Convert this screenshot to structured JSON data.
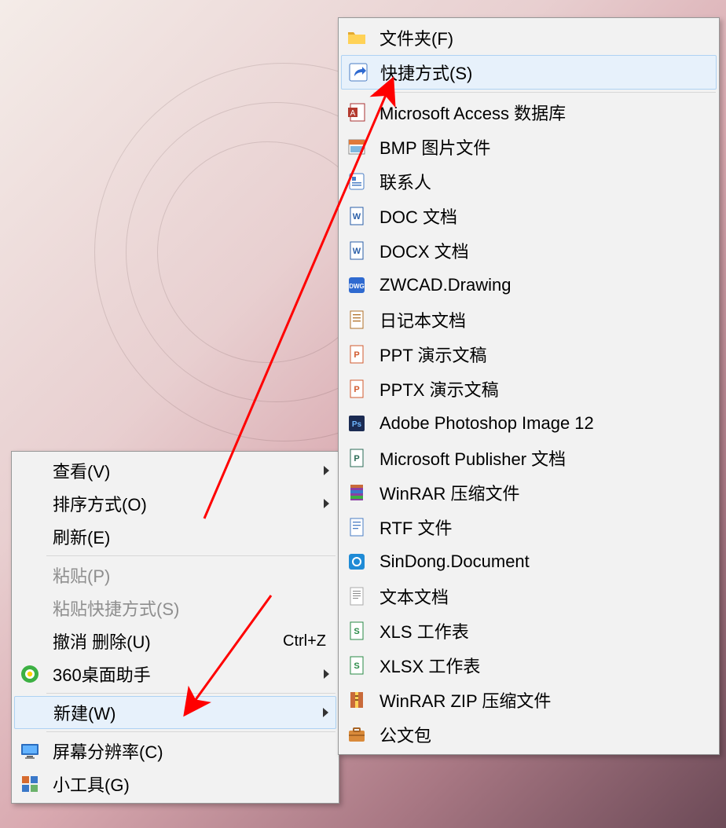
{
  "main_menu": {
    "view": {
      "label": "查看(V)"
    },
    "sort": {
      "label": "排序方式(O)"
    },
    "refresh": {
      "label": "刷新(E)"
    },
    "paste": {
      "label": "粘贴(P)"
    },
    "paste_shortcut": {
      "label": "粘贴快捷方式(S)"
    },
    "undo_delete": {
      "label": "撤消 删除(U)",
      "shortcut": "Ctrl+Z"
    },
    "helper_360": {
      "label": "360桌面助手"
    },
    "new": {
      "label": "新建(W)"
    },
    "screen_res": {
      "label": "屏幕分辨率(C)"
    },
    "gadgets": {
      "label": "小工具(G)"
    }
  },
  "sub_menu": {
    "folder": {
      "label": "文件夹(F)"
    },
    "shortcut": {
      "label": "快捷方式(S)"
    },
    "access": {
      "label": "Microsoft Access 数据库"
    },
    "bmp": {
      "label": "BMP 图片文件"
    },
    "contact": {
      "label": "联系人"
    },
    "doc": {
      "label": "DOC 文档"
    },
    "docx": {
      "label": "DOCX 文档"
    },
    "zwcad": {
      "label": "ZWCAD.Drawing"
    },
    "journal": {
      "label": "日记本文档"
    },
    "ppt": {
      "label": "PPT 演示文稿"
    },
    "pptx": {
      "label": "PPTX 演示文稿"
    },
    "psd": {
      "label": "Adobe Photoshop Image 12"
    },
    "publisher": {
      "label": "Microsoft Publisher 文档"
    },
    "rar": {
      "label": "WinRAR 压缩文件"
    },
    "rtf": {
      "label": "RTF 文件"
    },
    "sindong": {
      "label": "SinDong.Document"
    },
    "txt": {
      "label": "文本文档"
    },
    "xls": {
      "label": "XLS 工作表"
    },
    "xlsx": {
      "label": "XLSX 工作表"
    },
    "zip": {
      "label": "WinRAR ZIP 压缩文件"
    },
    "briefcase": {
      "label": "公文包"
    }
  },
  "colors": {
    "highlight_bg": "#e7f1fb",
    "highlight_border": "#aed2f3",
    "annotation": "#ff0000"
  }
}
